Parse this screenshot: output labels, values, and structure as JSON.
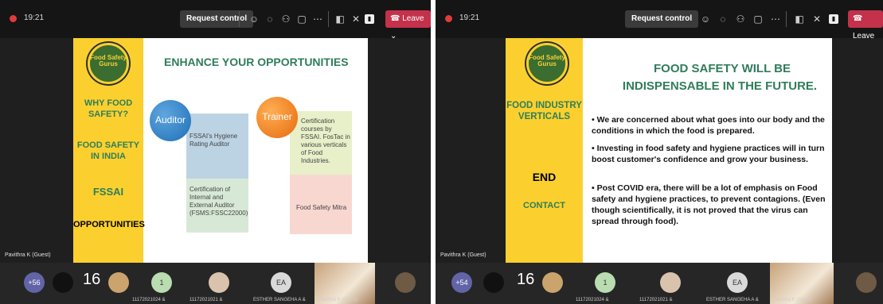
{
  "left": {
    "timer": "19:21",
    "request_control": "Request control",
    "leave": "Leave",
    "presenter": "Pavithra K (Guest)",
    "overflow_count": "+56",
    "count": "16",
    "avatar_1": "1",
    "avatar_2": "EA",
    "tile_label_1": "11172021024 &",
    "tile_label_2": "11172021021 &",
    "tile_label_3": "ESTHER SANGEHA A &",
    "tile_label_4": "Pavithra K (Guest)",
    "slide": {
      "logo_text": "Food Safety Gurus",
      "nav": [
        "WHY FOOD SAFETY?",
        "FOOD SAFETY IN INDIA",
        "FSSAI",
        "OPPORTUNITIES"
      ],
      "title": "ENHANCE YOUR OPPORTUNITIES",
      "auditor": "Auditor",
      "trainer": "Trainer",
      "box_1": "FSSAI's Hygiene Rating Auditor",
      "box_2": "Certification of Internal and External Auditor (FSMS:FSSC22000)",
      "box_3": "Certification courses by FSSAI. FosTac in various verticals of Food Industries.",
      "box_4": "Food Safety Mitra"
    }
  },
  "right": {
    "timer": "19:21",
    "request_control": "Request control",
    "leave": "Leave",
    "presenter": "Pavithra K (Guest)",
    "overflow_count": "+54",
    "count": "16",
    "avatar_1": "1",
    "avatar_2": "EA",
    "tile_label_1": "11172021024 &",
    "tile_label_2": "11172021021 &",
    "tile_label_3": "ESTHER SANGEHA A &",
    "tile_label_4": "Pavithra K (Guest)",
    "slide": {
      "logo_text": "Food Safety Gurus",
      "nav": [
        "FOOD INDUSTRY VERTICALS",
        "END",
        "CONTACT"
      ],
      "title_1": "FOOD SAFETY WILL BE",
      "title_2": "INDISPENSABLE IN THE FUTURE.",
      "bullet_1": "• We are concerned about what goes into our body and the conditions in which the food is prepared.",
      "bullet_2": "• Investing in food safety and hygiene practices will in turn boost customer's confidence and grow your business.",
      "bullet_3": "• Post COVID era, there will be a lot of emphasis on Food safety and hygiene practices, to prevent contagions. (Even though scientifically, it is not proved that the virus can spread through food)."
    }
  },
  "colors": {
    "accent_yellow": "#fbd02e",
    "leave_red": "#c4314b",
    "title_green": "#2f7d5a"
  },
  "icons": [
    "record-icon",
    "emoji-icon",
    "chat-icon",
    "participants-icon",
    "share-icon",
    "more-icon",
    "camera-off-icon",
    "mic-off-icon",
    "leave-phone-icon",
    "chevron-down-icon"
  ]
}
